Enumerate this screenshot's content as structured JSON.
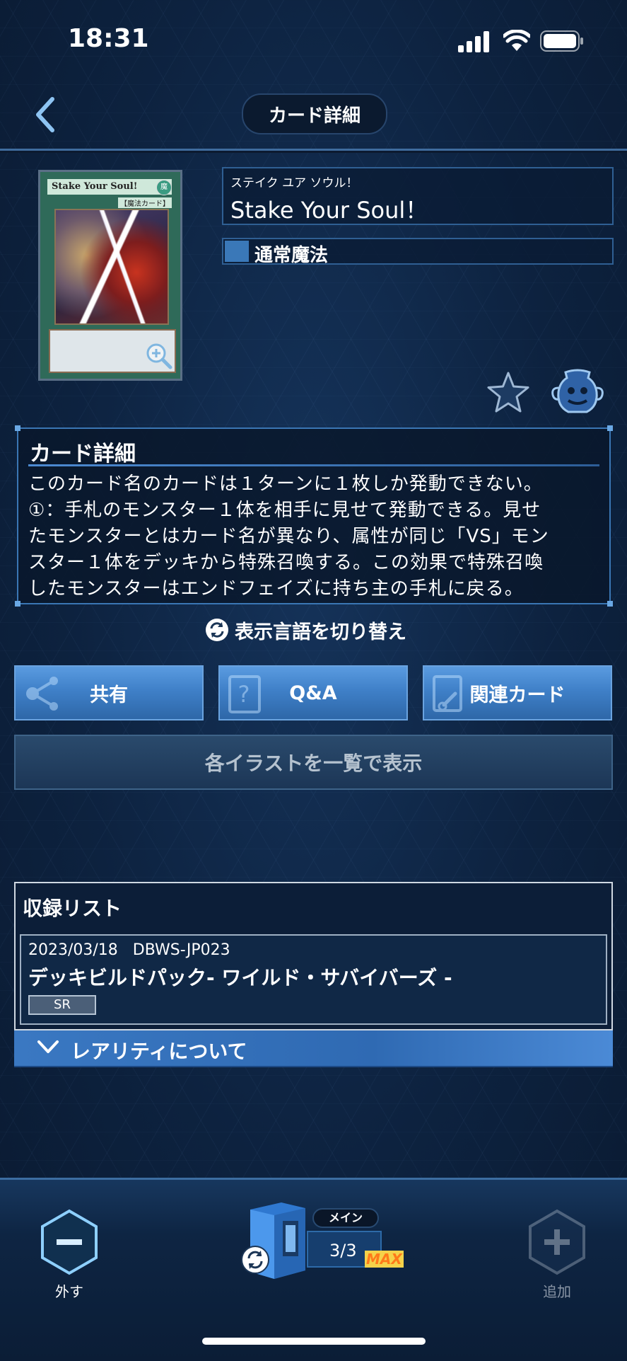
{
  "status_bar": {
    "time": "18:31"
  },
  "header": {
    "title": "カード詳細"
  },
  "card": {
    "image_name": "Stake Your Soul!",
    "image_type": "【魔法カード】",
    "image_attr": "魔",
    "ruby": "ステイク ユア ソウル！",
    "name": "Stake Your Soul！",
    "type": "通常魔法"
  },
  "detail": {
    "heading": "カード詳細",
    "lines": [
      "このカード名のカードは１ターンに１枚しか発動できない。",
      "①：手札のモンスター１体を相手に見せて発動できる。見せ",
      "たモンスターとはカード名が異なり、属性が同じ「VS」モン",
      "スター１体をデッキから特殊召喚する。この効果で特殊召喚",
      "したモンスターはエンドフェイズに持ち主の手札に戻る。"
    ]
  },
  "language_toggle": "表示言語を切り替え",
  "buttons": {
    "share": "共有",
    "qa": "Q&A",
    "related": "関連カード"
  },
  "illustration_button": "各イラストを一覧で表示",
  "recording": {
    "heading": "収録リスト",
    "items": [
      {
        "date": "2023/03/18",
        "code": "DBWS-JP023",
        "title": "デッキビルドパック- ワイルド・サバイバーズ -",
        "rarity": "SR"
      }
    ]
  },
  "rarity_info": "レアリティについて",
  "bottom": {
    "remove": "外す",
    "add": "追加",
    "deck_label": "メイン",
    "deck_count": "3/3",
    "max": "MAX"
  },
  "colors": {
    "accent": "#3f80c8",
    "max": "#ff7a1a"
  }
}
